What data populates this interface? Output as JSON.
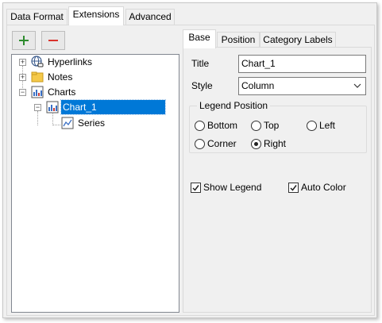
{
  "tabs": [
    {
      "label": "Data Format"
    },
    {
      "label": "Extensions"
    },
    {
      "label": "Advanced"
    }
  ],
  "active_tab": "Extensions",
  "toolbar": {
    "add_symbol": "+",
    "remove_symbol": "−",
    "add_color": "#2e8b2e",
    "remove_color": "#d9322b"
  },
  "tree": {
    "items": [
      {
        "label": "Hyperlinks",
        "icon": "globe-link-icon"
      },
      {
        "label": "Notes",
        "icon": "folder-note-icon"
      },
      {
        "label": "Charts",
        "icon": "chart-icon"
      },
      {
        "label": "Chart_1",
        "icon": "chart-icon",
        "selected": true
      },
      {
        "label": "Series",
        "icon": "line-series-icon"
      }
    ]
  },
  "props_tabs": [
    {
      "label": "Base"
    },
    {
      "label": "Position"
    },
    {
      "label": "Category Labels"
    }
  ],
  "form": {
    "title_label": "Title",
    "title_value": "Chart_1",
    "style_label": "Style",
    "style_value": "Column",
    "legend_group": "Legend Position",
    "radios": [
      {
        "label": "Bottom",
        "checked": false
      },
      {
        "label": "Top",
        "checked": false
      },
      {
        "label": "Left",
        "checked": false
      },
      {
        "label": "Corner",
        "checked": false
      },
      {
        "label": "Right",
        "checked": true
      }
    ],
    "show_legend_label": "Show Legend",
    "show_legend_checked": true,
    "auto_color_label": "Auto Color",
    "auto_color_checked": true
  },
  "colors": {
    "selection": "#0078d7"
  }
}
